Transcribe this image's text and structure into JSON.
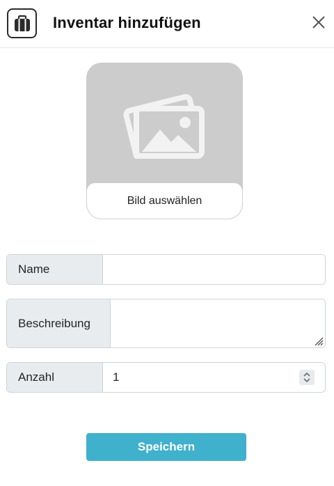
{
  "header": {
    "title": "Inventar hinzufügen",
    "app_icon": "suitcase-icon",
    "close_icon": "close-icon"
  },
  "image_picker": {
    "placeholder_icon": "images-icon",
    "select_label": "Bild auswählen"
  },
  "form": {
    "name": {
      "label": "Name",
      "value": ""
    },
    "description": {
      "label": "Beschreibung",
      "value": ""
    },
    "quantity": {
      "label": "Anzahl",
      "value": "1"
    }
  },
  "actions": {
    "save_label": "Speichern"
  },
  "colors": {
    "primary": "#3fb1cc",
    "label_bg": "#e9ecef",
    "placeholder_bg": "#cccccc"
  }
}
